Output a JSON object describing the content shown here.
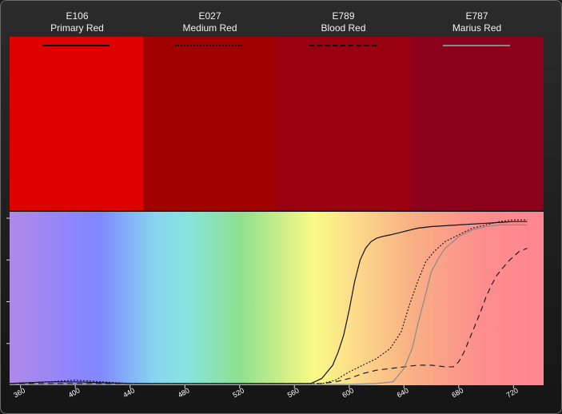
{
  "filters": [
    {
      "code": "E106",
      "name": "Primary Red",
      "color": "#df0000",
      "line_style": "solid",
      "line_color": "#111111"
    },
    {
      "code": "E027",
      "name": "Medium Red",
      "color": "#a10000",
      "line_style": "dotted",
      "line_color": "#111111"
    },
    {
      "code": "E789",
      "name": "Blood Red",
      "color": "#990010",
      "line_style": "dashed",
      "line_color": "#111111"
    },
    {
      "code": "E787",
      "name": "Marius Red",
      "color": "#8c001c",
      "line_style": "solid",
      "line_color": "#8a8a8a"
    }
  ],
  "chart_data": {
    "type": "line",
    "title": "",
    "xlabel": "",
    "ylabel": "",
    "xlim": [
      352,
      742
    ],
    "ylim": [
      0,
      100
    ],
    "xticks": [
      360,
      400,
      440,
      480,
      520,
      560,
      600,
      640,
      680,
      720
    ],
    "y_tick_marks": [
      25,
      50,
      75,
      100
    ],
    "background": "visible spectrum gradient",
    "series": [
      {
        "code": "E106",
        "style": "solid",
        "color": "#111111",
        "x": [
          352,
          380,
          400,
          420,
          440,
          560,
          572,
          580,
          588,
          592,
          596,
          600,
          604,
          608,
          612,
          616,
          620,
          624,
          630,
          640,
          650,
          660,
          680,
          700,
          720,
          730
        ],
        "y": [
          1,
          2,
          2,
          1.5,
          1,
          1,
          1,
          4,
          12,
          20,
          30,
          45,
          62,
          75,
          82,
          86,
          88,
          89,
          90,
          92,
          94,
          95,
          96,
          97,
          98,
          98
        ]
      },
      {
        "code": "E027",
        "style": "dotted",
        "color": "#111111",
        "x": [
          352,
          380,
          400,
          420,
          440,
          560,
          580,
          590,
          600,
          610,
          620,
          630,
          638,
          644,
          650,
          656,
          662,
          670,
          680,
          690,
          700,
          710,
          720,
          730
        ],
        "y": [
          1,
          2,
          3,
          2,
          1,
          1,
          1,
          3,
          8,
          12,
          16,
          22,
          32,
          48,
          62,
          74,
          80,
          86,
          90,
          94,
          96,
          98,
          99,
          99
        ]
      },
      {
        "code": "E789",
        "style": "dashed",
        "color": "#111111",
        "x": [
          352,
          440,
          580,
          590,
          600,
          610,
          620,
          630,
          640,
          650,
          660,
          670,
          676,
          680,
          684,
          688,
          692,
          696,
          700,
          704,
          708,
          712,
          716,
          720,
          724,
          730
        ],
        "y": [
          1,
          1,
          1,
          2,
          4,
          7,
          9,
          10,
          11,
          12,
          12,
          11,
          11,
          14,
          20,
          28,
          36,
          44,
          53,
          60,
          66,
          70,
          74,
          77,
          80,
          82
        ]
      },
      {
        "code": "E787",
        "style": "solid",
        "color": "#8a8a8a",
        "x": [
          352,
          600,
          620,
          632,
          640,
          646,
          650,
          656,
          660,
          666,
          670,
          676,
          680,
          690,
          700,
          710,
          720,
          730
        ],
        "y": [
          0.5,
          0.5,
          1,
          2,
          10,
          22,
          36,
          55,
          68,
          77,
          82,
          86,
          89,
          93,
          95,
          96,
          96,
          96
        ]
      }
    ]
  }
}
